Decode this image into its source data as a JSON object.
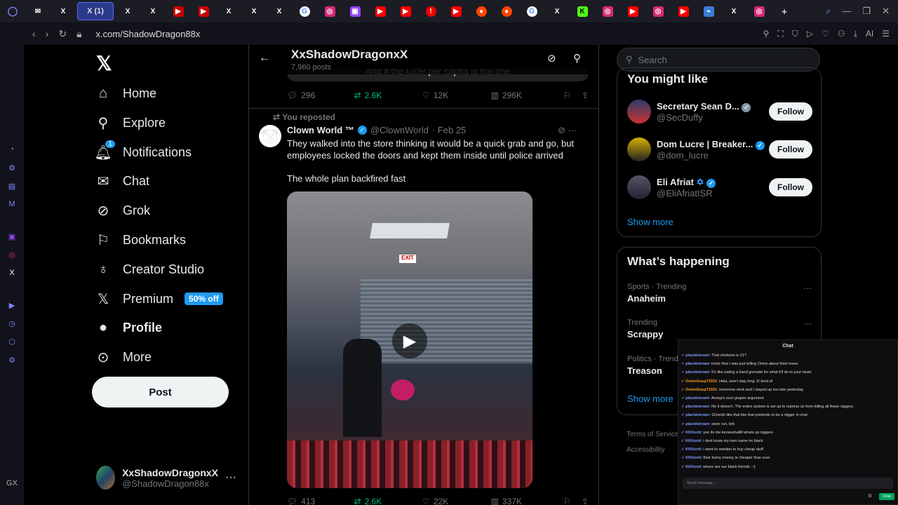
{
  "browser": {
    "tabs": [
      "✉",
      "X",
      "X (1)",
      "X",
      "X",
      "▶",
      "▶",
      "X",
      "X",
      "X",
      "G",
      "◎",
      "▣",
      "▶",
      "▶",
      "!",
      "▶",
      "●",
      "●",
      "G",
      "X",
      "K",
      "◎",
      "▶",
      "◎",
      "▶",
      "⌁",
      "X",
      "◎",
      "+"
    ],
    "url": "x.com/ShadowDragon88x",
    "ai_label": "AI"
  },
  "nav": {
    "home": "Home",
    "explore": "Explore",
    "notifications": "Notifications",
    "notifications_badge": "1",
    "chat": "Chat",
    "grok": "Grok",
    "bookmarks": "Bookmarks",
    "creator_studio": "Creator Studio",
    "premium": "Premium",
    "premium_badge": "50% off",
    "profile": "Profile",
    "more": "More",
    "post": "Post",
    "account_name": "XxShadowDragonxX",
    "account_handle": "@ShadowDragon88x"
  },
  "header": {
    "title": "XxShadowDragonxX",
    "subtitle": "7,960 posts",
    "prev_caption": "And if the GDP per capita is the one"
  },
  "prev_actions": {
    "replies": "296",
    "reposts": "2.6K",
    "likes": "12K",
    "views": "296K"
  },
  "tweet": {
    "repost_note": "You reposted",
    "name": "Clown World ™",
    "handle": "@ClownWorld",
    "date": "· Feb 25",
    "text": "They walked into the store thinking it would be a quick grab and go, but employees locked the doors and kept them inside until police arrived",
    "text2": "The whole plan backfired fast",
    "exit_sign": "EXIT",
    "replies": "413",
    "reposts": "2.6K",
    "likes": "22K",
    "views": "337K"
  },
  "right": {
    "search_placeholder": "Search",
    "you_might_like": "You might like",
    "suggestions": [
      {
        "name": "Secretary Sean D...",
        "handle": "@SecDuffy",
        "follow": "Follow"
      },
      {
        "name": "Dom Lucre | Breaker...",
        "handle": "@dom_lucre",
        "follow": "Follow"
      },
      {
        "name": "Eli Afriat",
        "handle": "@EliAfriatISR",
        "follow": "Follow"
      }
    ],
    "show_more_1": "Show more",
    "whats_happening": "What’s happening",
    "trends": [
      {
        "category": "Sports · Trending",
        "title": "Anaheim"
      },
      {
        "category": "Trending",
        "title": "Scrappy"
      },
      {
        "category": "Politics · Trend",
        "title": "Treason"
      }
    ],
    "show_more_2": "Show more",
    "footer_1": "Terms of Service",
    "footer_2": "Accessibility"
  },
  "chat": {
    "title": "Chat",
    "messages": [
      {
        "user": "placidstream",
        "text": "That sheboon is 21?"
      },
      {
        "user": "placidstream",
        "text": "ironic that I was just telling Onion about fried oreos"
      },
      {
        "user": "placidstream",
        "text": "It's like eating a hand grenade for what it'll do to your heart"
      },
      {
        "user": "OnionSoup71551",
        "text": "Hola, won't stay long :D tired af"
      },
      {
        "user": "OnionSoup71551",
        "text": "tomorrow work and I stayed up too late yesterday"
      },
      {
        "user": "placidstream",
        "text": "Aesop's sour grapes argument"
      },
      {
        "user": "placidstream",
        "text": "No it doesn't. The entire system is set up to repress us from killing all those niggers."
      },
      {
        "user": "placidstream",
        "text": "SOunds like that like that pretends to be a nigger in chat"
      },
      {
        "user": "placidstream",
        "text": "store run, brb"
      },
      {
        "user": "KKKonti",
        "text": "yoo its me koneeshalllll whats up niggers"
      },
      {
        "user": "KKKonti",
        "text": "i dont know my own name im black"
      },
      {
        "user": "KKKonti",
        "text": "i went to sweden to buy cheap stuff"
      },
      {
        "user": "KKKonti",
        "text": "their funny money is cheaper than euro"
      },
      {
        "user": "KKKonti",
        "text": "where are our black friends :~["
      }
    ],
    "input_placeholder": "Send message...",
    "send": "Chat"
  },
  "colors": {
    "accent": "#1d9bf0",
    "repost_green": "#00ba7c",
    "background": "#000000"
  }
}
